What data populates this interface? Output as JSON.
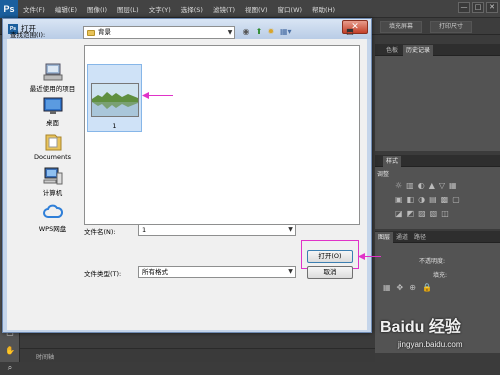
{
  "app": {
    "logo": "Ps",
    "menus": [
      "文件(F)",
      "编辑(E)",
      "图像(I)",
      "图层(L)",
      "文字(Y)",
      "选择(S)",
      "滤镜(T)",
      "视图(V)",
      "窗口(W)",
      "帮助(H)"
    ],
    "window_controls": [
      "—",
      "□",
      "✕"
    ],
    "options_buttons": [
      "填充屏幕",
      "打印尺寸"
    ]
  },
  "panels": {
    "history_tabs": [
      "色板",
      "历史记录"
    ],
    "adjust_tabs": [
      "样式"
    ],
    "adjust_title": "调整",
    "layers_tabs": [
      "图层",
      "通道",
      "路径"
    ],
    "opacity_label": "不透明度:",
    "fill_label": "填充:"
  },
  "dialog": {
    "title_icon": "Ps",
    "title": "打开",
    "close_glyph": "✕",
    "look_in_label": "查找范围(I):",
    "look_in_value": "背景",
    "places": [
      {
        "label": "最近使用的项目",
        "icon": "recent-items-icon"
      },
      {
        "label": "桌面",
        "icon": "desktop-icon"
      },
      {
        "label": "Documents",
        "icon": "documents-icon"
      },
      {
        "label": "计算机",
        "icon": "computer-icon"
      },
      {
        "label": "WPS网盘",
        "icon": "cloud-icon"
      }
    ],
    "files": [
      {
        "name": "1"
      }
    ],
    "filename_label": "文件名(N):",
    "filename_value": "1",
    "filetype_label": "文件类型(T):",
    "filetype_value": "所有格式",
    "open_button": "打开(O)",
    "cancel_button": "取消"
  },
  "status": {
    "timeline": "时间轴"
  },
  "watermark": {
    "text": "Baidu 经验",
    "url": "jingyan.baidu.com"
  },
  "colors": {
    "annotation": "#e033c8",
    "dialog_frame": "#c5d5ea",
    "ps_blue": "#1b5f9e"
  }
}
